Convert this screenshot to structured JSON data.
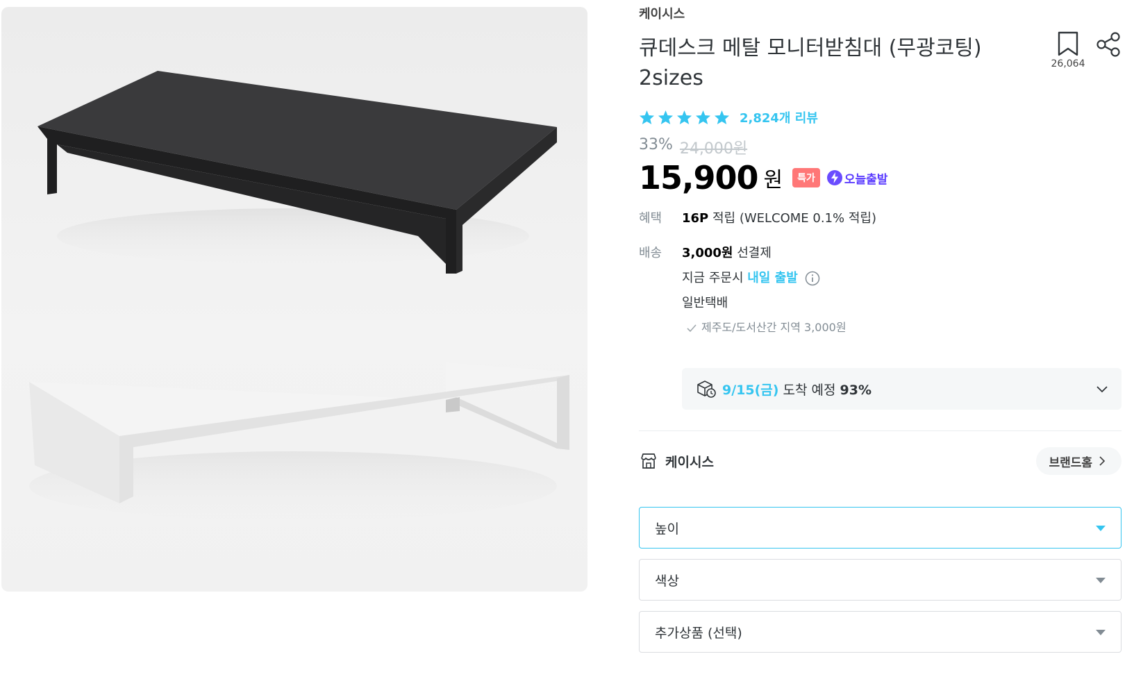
{
  "product": {
    "brand": "케이시스",
    "title_line1": "큐데스크 메탈 모니터받침대 (무광코팅)",
    "title_line2": "2sizes",
    "scrap_count": "26,064",
    "rating": 5,
    "review_count_label": "2,824개 리뷰"
  },
  "price": {
    "discount": "33%",
    "original": "24,000원",
    "current": "15,900",
    "currency": "원",
    "badge_special": "특가",
    "badge_today": "오늘출발"
  },
  "benefit": {
    "label": "혜택",
    "points": "16P",
    "text": " 적립 (WELCOME 0.1% 적립)"
  },
  "shipping": {
    "label": "배송",
    "fee": "3,000원",
    "fee_suffix": " 선결제",
    "order_prefix": "지금 주문시 ",
    "order_highlight": "내일 출발",
    "method": "일반택배",
    "remote_note": "제주도/도서산간 지역 3,000원"
  },
  "eta": {
    "date": "9/15(금)",
    "text": " 도착 예정 ",
    "percent": "93%"
  },
  "store": {
    "name": "케이시스",
    "brand_home_label": "브랜드홈"
  },
  "options": [
    {
      "placeholder": "높이",
      "active": true
    },
    {
      "placeholder": "색상",
      "active": false
    },
    {
      "placeholder": "추가상품 (선택)",
      "active": false
    }
  ],
  "colors": {
    "accent": "#35c5f0",
    "special_badge": "#ff7777",
    "today_badge": "#5b3cff"
  }
}
